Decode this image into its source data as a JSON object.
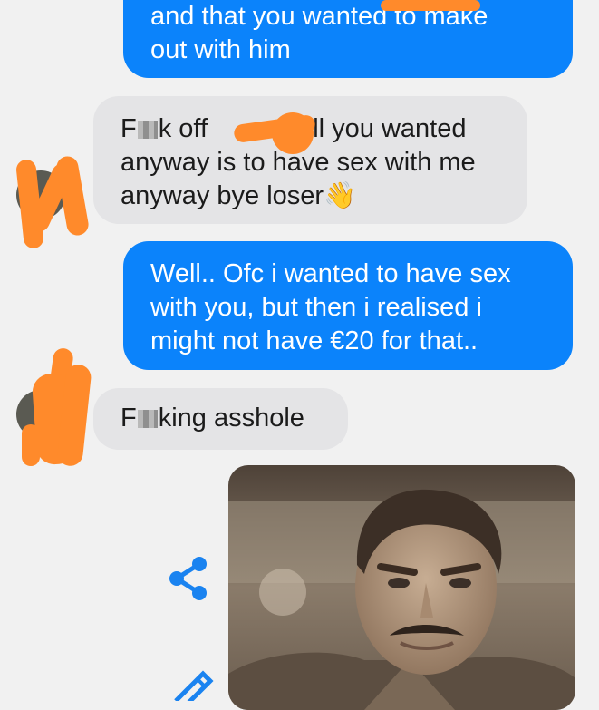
{
  "colors": {
    "background": "#f1f1f1",
    "outgoing_bubble": "#0b83fb",
    "incoming_bubble": "#e4e4e6",
    "action_icon": "#1a83f0",
    "redaction_mark": "#ff8a2b"
  },
  "messages": [
    {
      "sender": "me",
      "lines": [
        "and that you wanted to make",
        "out with him"
      ]
    },
    {
      "sender": "them",
      "lines": [
        "F",
        "k off ",
        "all you wanted",
        "anyway is to have sex with me",
        "anyway bye loser",
        "👋"
      ]
    },
    {
      "sender": "me",
      "lines": [
        "Well.. Ofc i wanted to have sex",
        "with you, but then i realised i",
        "might not have €20 for that.."
      ]
    },
    {
      "sender": "them",
      "lines": [
        "F",
        "king asshole"
      ]
    }
  ],
  "icons": {
    "share": "share-icon",
    "edit": "pencil-icon"
  }
}
